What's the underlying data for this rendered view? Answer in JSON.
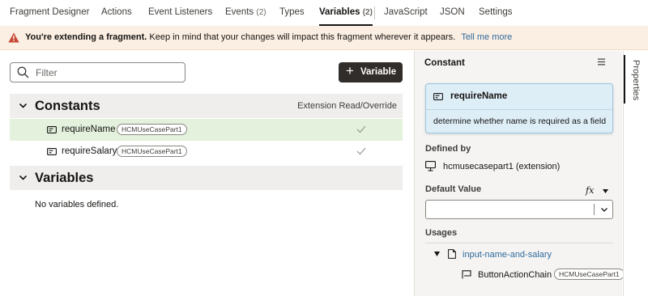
{
  "tabs": [
    {
      "label": "Fragment Designer",
      "count": ""
    },
    {
      "label": "Actions",
      "count": ""
    },
    {
      "label": "Event Listeners",
      "count": ""
    },
    {
      "label": "Events",
      "count": "(2)"
    },
    {
      "label": "Types",
      "count": ""
    },
    {
      "label": "Variables",
      "count": "(2)"
    },
    {
      "label": "JavaScript",
      "count": ""
    },
    {
      "label": "JSON",
      "count": ""
    },
    {
      "label": "Settings",
      "count": ""
    }
  ],
  "active_tab": "Variables",
  "banner": {
    "bold": "You're extending a fragment.",
    "text": "Keep in mind that your changes will impact this fragment wherever it appears.",
    "link": "Tell me more"
  },
  "filter": {
    "placeholder": "Filter",
    "value": ""
  },
  "add_variable_button": {
    "icon": "+",
    "label": "Variable"
  },
  "constants": {
    "title": "Constants",
    "column_label": "Extension Read/Override",
    "items": [
      {
        "name": "requireName",
        "badge": "HCMUseCasePart1",
        "selected": true
      },
      {
        "name": "requireSalary",
        "badge": "HCMUseCasePart1",
        "selected": false
      }
    ]
  },
  "variables": {
    "title": "Variables",
    "empty_text": "No variables defined."
  },
  "properties": {
    "header": "Constant",
    "card_title": "requireName",
    "card_description": "determine whether name is required as a field",
    "defined_by_label": "Defined by",
    "defined_by_value": "hcmusecasepart1 (extension)",
    "default_value_label": "Default Value",
    "fx_label": "fx",
    "default_value": "",
    "usages_label": "Usages",
    "usage_item": "input-name-and-salary",
    "usage_child": "ButtonActionChain",
    "usage_child_badge": "HCMUseCasePart1"
  },
  "side_tab": "Properties",
  "colors": {
    "banner_bg": "#fbeee2",
    "warning": "#c74634",
    "selected_row": "#e3f1dd",
    "link": "#2e6b9f",
    "primary_button": "#312d2a"
  }
}
